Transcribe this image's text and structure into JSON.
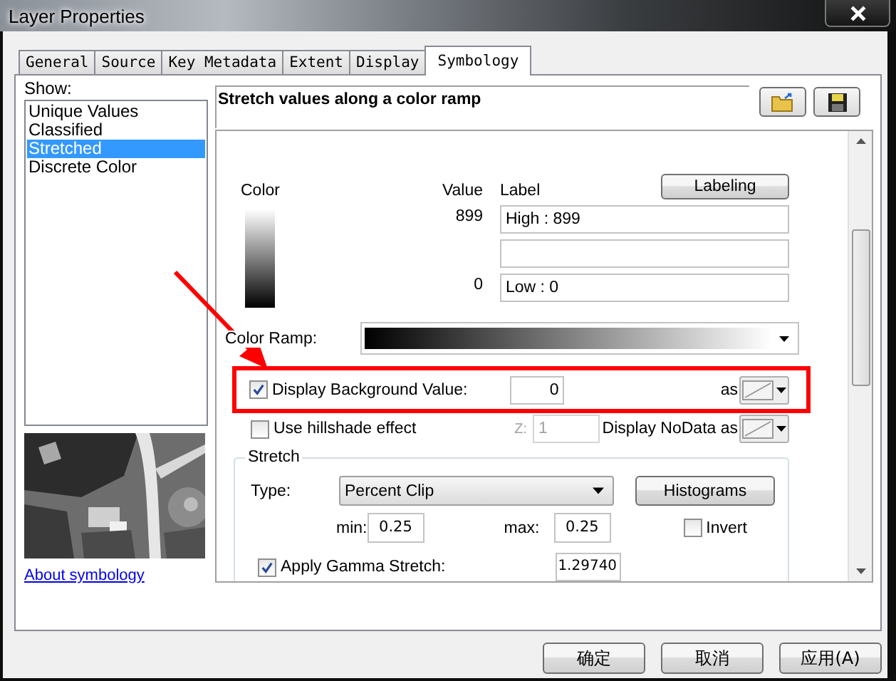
{
  "window": {
    "title": "Layer Properties"
  },
  "tabs": [
    {
      "label": "General",
      "selected": false
    },
    {
      "label": "Source",
      "selected": false
    },
    {
      "label": "Key Metadata",
      "selected": false
    },
    {
      "label": "Extent",
      "selected": false
    },
    {
      "label": "Display",
      "selected": false
    },
    {
      "label": "Symbology",
      "selected": true
    }
  ],
  "show": {
    "label": "Show:",
    "items": [
      {
        "label": "Unique Values",
        "selected": false
      },
      {
        "label": "Classified",
        "selected": false
      },
      {
        "label": "Stretched",
        "selected": true
      },
      {
        "label": "Discrete Color",
        "selected": false
      }
    ]
  },
  "preview": {
    "kind": "picture"
  },
  "about_link": "About symbology",
  "header": {
    "title": "Stretch values along a color ramp"
  },
  "legend": {
    "color_label": "Color",
    "value_label": "Value",
    "label_label": "Label",
    "labeling_button": "Labeling",
    "rows": [
      {
        "value": "899",
        "label": "High : 899"
      },
      {},
      {
        "value": "0",
        "label": "Low : 0"
      }
    ]
  },
  "color_ramp": {
    "label": "Color Ramp:"
  },
  "background": {
    "label": "Display Background Value:",
    "checked": true,
    "value": "0",
    "as_label": "as"
  },
  "hillshade": {
    "label": "Use hillshade effect",
    "checked": false,
    "z_label": "Z:",
    "z_value": "1",
    "z_disabled": true
  },
  "nodata": {
    "label": "Display NoData as"
  },
  "stretch": {
    "title": "Stretch",
    "type_label": "Type:",
    "type_value": "Percent Clip",
    "histograms_button": "Histograms",
    "min_label": "min:",
    "min_value": "0.25",
    "max_label": "max:",
    "max_value": "0.25",
    "invert": {
      "label": "Invert",
      "checked": false
    },
    "gamma": {
      "label": "Apply Gamma Stretch:",
      "checked": true,
      "value": "1.29740"
    }
  },
  "buttons": [
    "确定",
    "取消",
    "应用(A)"
  ]
}
